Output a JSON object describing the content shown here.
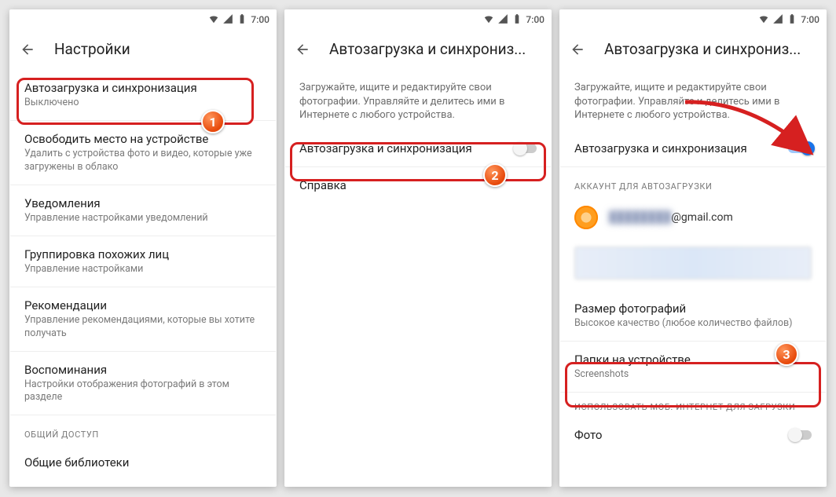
{
  "status": {
    "time": "7:00"
  },
  "screen1": {
    "title": "Настройки",
    "items": [
      {
        "title": "Автозагрузка и синхронизация",
        "sub": "Выключено"
      },
      {
        "title": "Освободить место на устройстве",
        "sub": "Удалить с устройства фото и видео, которые уже загружены в облако"
      },
      {
        "title": "Уведомления",
        "sub": "Управление настройками уведомлений"
      },
      {
        "title": "Группировка похожих лиц",
        "sub": "Управление настройками"
      },
      {
        "title": "Рекомендации",
        "sub": "Управление рекомендациями, которые вы хотите получать"
      },
      {
        "title": "Воспоминания",
        "sub": "Настройки отображения фотографий в этом разделе"
      }
    ],
    "section_general": "ОБЩИЙ ДОСТУП",
    "general_item": "Общие библиотеки"
  },
  "screen2": {
    "title": "Автозагрузка и синхрониз...",
    "desc": "Загружайте, ищите и редактируйте свои фотографии. Управляйте и делитесь ими в Интернете с любого устройства.",
    "toggle_label": "Автозагрузка и синхронизация",
    "help": "Справка"
  },
  "screen3": {
    "title": "Автозагрузка и синхрониз...",
    "desc": "Загружайте, ищите и редактируйте свои фотографии. Управляйте и делитесь ими в Интернете с любого устройства.",
    "toggle_label": "Автозагрузка и синхронизация",
    "section_account": "АККАУНТ ДЛЯ АВТОЗАГРУЗКИ",
    "email_suffix": "@gmail.com",
    "size_title": "Размер фотографий",
    "size_sub": "Высокое качество (любое количество файлов)",
    "folders_title": "Папки на устройстве",
    "folders_sub": "Screenshots",
    "section_mobile": "ИСПОЛЬЗОВАТЬ МОБ. ИНТЕРНЕТ ДЛЯ ЗАГРУЗКИ",
    "mobile_photo": "Фото"
  },
  "badges": {
    "b1": "1",
    "b2": "2",
    "b3": "3"
  }
}
